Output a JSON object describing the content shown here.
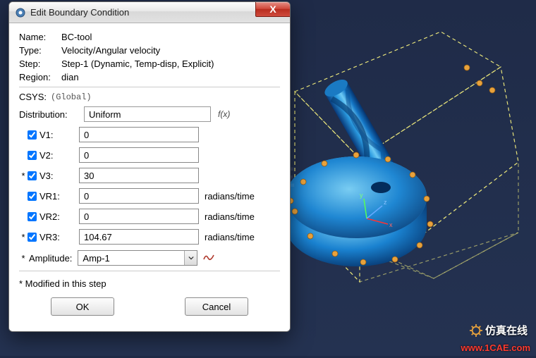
{
  "dialog": {
    "title": "Edit Boundary Condition",
    "close_glyph": "X",
    "name_label": "Name:",
    "name_value": "BC-tool",
    "type_label": "Type:",
    "type_value": "Velocity/Angular velocity",
    "step_label": "Step:",
    "step_value": "Step-1 (Dynamic, Temp-disp, Explicit)",
    "region_label": "Region:",
    "region_value": "dian",
    "csys_label": "CSYS:",
    "csys_value": "(Global)",
    "dist_label": "Distribution:",
    "dist_value": "Uniform",
    "fx_label": "f(x)",
    "fields": [
      {
        "star": " ",
        "checked": true,
        "label": "V1:",
        "value": "0",
        "unit": ""
      },
      {
        "star": " ",
        "checked": true,
        "label": "V2:",
        "value": "0",
        "unit": ""
      },
      {
        "star": "*",
        "checked": true,
        "label": "V3:",
        "value": "30",
        "unit": ""
      },
      {
        "star": " ",
        "checked": true,
        "label": "VR1:",
        "value": "0",
        "unit": "radians/time"
      },
      {
        "star": " ",
        "checked": true,
        "label": "VR2:",
        "value": "0",
        "unit": "radians/time"
      },
      {
        "star": "*",
        "checked": true,
        "label": "VR3:",
        "value": "104.67",
        "unit": "radians/time"
      }
    ],
    "amp_star": "*",
    "amp_label": "Amplitude:",
    "amp_value": "Amp-1",
    "note": "* Modified in this step",
    "ok_label": "OK",
    "cancel_label": "Cancel"
  },
  "viewport": {
    "watermark_brand": "仿真在线",
    "url": "www.1CAE.com"
  }
}
